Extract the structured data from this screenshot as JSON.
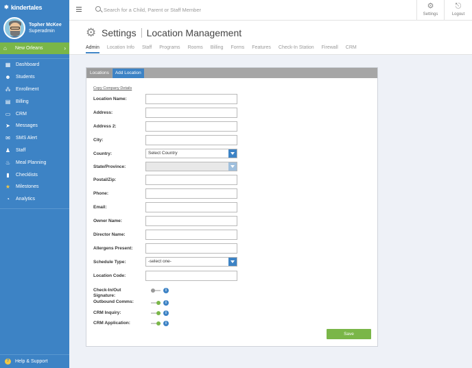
{
  "brand": {
    "name": "kindertales"
  },
  "profile": {
    "name": "Topher McKee",
    "role": "Superadmin"
  },
  "location": {
    "name": "New Orleans"
  },
  "sidebar": {
    "items": [
      {
        "label": "Dashboard",
        "icon": "dashboard-icon"
      },
      {
        "label": "Students",
        "icon": "students-icon"
      },
      {
        "label": "Enrollment",
        "icon": "enrollment-icon"
      },
      {
        "label": "Billing",
        "icon": "billing-icon"
      },
      {
        "label": "CRM",
        "icon": "crm-icon"
      },
      {
        "label": "Messages",
        "icon": "messages-icon"
      },
      {
        "label": "SMS Alert",
        "icon": "sms-alert-icon"
      },
      {
        "label": "Staff",
        "icon": "staff-icon"
      },
      {
        "label": "Meal Planning",
        "icon": "meal-planning-icon"
      },
      {
        "label": "Checklists",
        "icon": "checklists-icon"
      },
      {
        "label": "Milestones",
        "icon": "milestones-icon"
      },
      {
        "label": "Analytics",
        "icon": "analytics-icon"
      }
    ],
    "help": "Help & Support"
  },
  "topbar": {
    "search_placeholder": "Search for a Child, Parent or Staff Member",
    "settings_label": "Settings",
    "logout_label": "Logout"
  },
  "header": {
    "title": "Settings",
    "subtitle": "Location Management",
    "tabs": [
      "Admin",
      "Location Info",
      "Staff",
      "Programs",
      "Rooms",
      "Billing",
      "Forms",
      "Features",
      "Check-In Station",
      "Firewall",
      "CRM"
    ]
  },
  "panel": {
    "tabs": [
      "Locations",
      "Add Location"
    ],
    "copy_link": "Copy Company Details",
    "fields": {
      "location_name": "Location Name:",
      "address": "Address:",
      "address2": "Address 2:",
      "city": "City:",
      "country": "Country:",
      "state": "State/Province:",
      "postal": "Postal/Zip:",
      "phone": "Phone:",
      "email": "Email:",
      "owner": "Owner Name:",
      "director": "Director Name:",
      "allergens": "Allergens Present:",
      "schedule_type": "Schedule Type:",
      "location_code": "Location Code:",
      "checkin_sig": "Check-In/Out Signature:",
      "outbound": "Outbound Comms:",
      "crm_inquiry": "CRM Inquiry:",
      "crm_application": "CRM Application:"
    },
    "country_value": "Select Country",
    "state_value": "",
    "schedule_value": "-select one-",
    "toggles": {
      "checkin_sig": false,
      "outbound": true,
      "crm_inquiry": true,
      "crm_application": true
    },
    "save_label": "Save"
  },
  "colors": {
    "primary": "#3d83c5",
    "accent_green": "#7ab648",
    "content_bg": "#eef1f7"
  }
}
